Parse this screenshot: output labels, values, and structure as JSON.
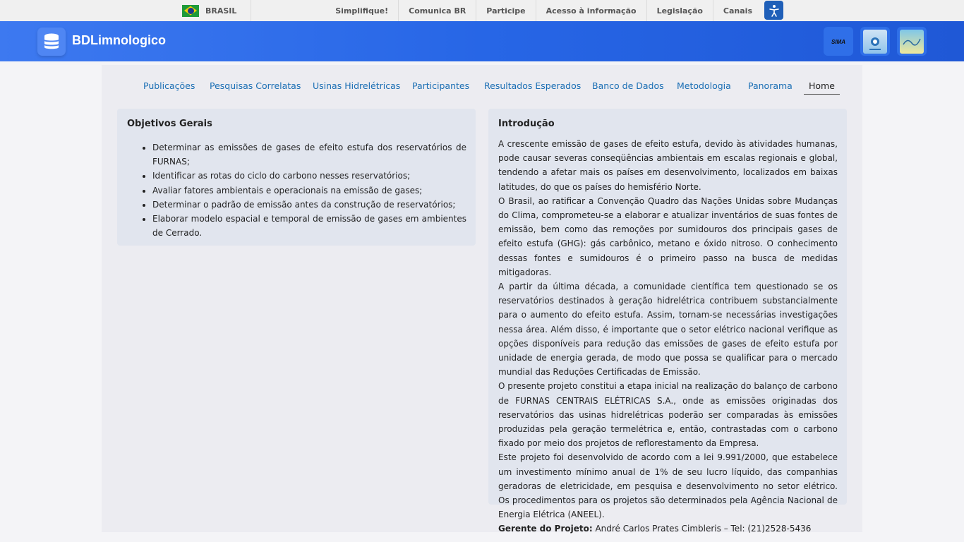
{
  "gov_bar": {
    "country": "BRASIL",
    "links": [
      "Simplifique!",
      "Comunica BR",
      "Participe",
      "Acesso à informação",
      "Legislação",
      "Canais"
    ]
  },
  "header": {
    "title": "BDLimnologico",
    "partners": [
      "SIMA",
      "Furnas",
      "Partner logo"
    ]
  },
  "nav": {
    "items": [
      "Publicações",
      "Pesquisas Correlatas",
      "Usinas Hidrelétricas",
      "Participantes",
      "Resultados Esperados",
      "Banco de Dados",
      "Metodologia",
      "Panorama",
      "Home"
    ],
    "active": "Home"
  },
  "objetivos": {
    "title": "Objetivos Gerais",
    "items": [
      "Determinar as emissões de gases de efeito estufa dos reservatórios de FURNAS;",
      "Identificar as rotas do ciclo do carbono nesses reservatórios;",
      "Avaliar fatores ambientais e operacionais na emissão de gases;",
      "Determinar o padrão de emissão antes da construção de reservatórios;",
      "Elaborar modelo espacial e temporal de emissão de gases em ambientes de Cerrado."
    ]
  },
  "introducao": {
    "title": "Introdução",
    "paragraphs": [
      "A crescente emissão de gases de efeito estufa, devido às atividades humanas, pode causar severas conseqüências ambientais em escalas regionais e global, tendendo a afetar mais os países em desenvolvimento, localizados em baixas latitudes, do que os países do hemisfério Norte.",
      "O Brasil, ao ratificar a Convenção Quadro das Nações Unidas sobre Mudanças do Clima, comprometeu-se a elaborar e atualizar inventários de suas fontes de emissão, bem como das remoções por sumidouros dos principais gases de efeito estufa (GHG): gás carbônico, metano e óxido nitroso. O conhecimento dessas fontes e sumidouros é o primeiro passo na busca de medidas mitigadoras.",
      "A partir da última década, a comunidade científica tem questionado se os reservatórios destinados à geração hidrelétrica contribuem substancialmente para o aumento do efeito estufa. Assim, tornam-se necessárias investigações nessa área. Além disso, é importante que o setor elétrico nacional verifique as opções disponíveis para redução das emissões de gases de efeito estufa por unidade de energia gerada, de modo que possa se qualificar para o mercado mundial das Reduções Certificadas de Emissão.",
      "O presente projeto constitui a etapa inicial na realização do balanço de carbono de FURNAS CENTRAIS ELÉTRICAS S.A., onde as emissões originadas dos reservatórios das usinas hidrelétricas poderão ser comparadas às emissões produzidas pela geração termelétrica e, então, contrastadas com o carbono fixado por meio dos projetos de reflorestamento da Empresa.",
      "Este projeto foi desenvolvido de acordo com a lei 9.991/2000, que estabelece um investimento mínimo anual de 1% de seu lucro líquido, das companhias geradoras de eletricidade, em pesquisa e desenvolvimento no setor elétrico. Os procedimentos para os projetos são determinados pela Agência Nacional de Energia Elétrica (ANEEL)."
    ],
    "manager_label": "Gerente do Projeto:",
    "manager_value": " André Carlos Prates Cimbleris – Tel: (21)2528-5436"
  },
  "colors": {
    "header_blue": "#2766e6",
    "link_blue": "#1a6eb4",
    "card_bg": "#e1e5ee"
  }
}
